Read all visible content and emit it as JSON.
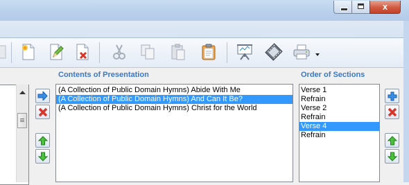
{
  "window": {
    "close_label": "x"
  },
  "toolbar": {
    "icons": [
      "new-document-icon",
      "edit-document-icon",
      "delete-document-icon",
      "cut-icon",
      "copy-icon",
      "paste-icon",
      "clipboard-icon",
      "presentation-easel-icon",
      "film-icon",
      "print-icon"
    ]
  },
  "contents": {
    "title": "Contents of Presentation",
    "items": [
      "(A Collection of Public Domain Hymns) Abide With Me",
      "(A Collection of Public Domain Hymns) And Can It Be?",
      "(A Collection of Public Domain Hymns) Christ for the World"
    ],
    "selected_index": 1
  },
  "sections": {
    "title": "Order of Sections",
    "items": [
      "Verse 1",
      "Refrain",
      "Verse 2",
      "Refrain",
      "Verse 4",
      "Refrain"
    ],
    "selected_index": 4
  },
  "colors": {
    "accent_label": "#3a78c9",
    "selection": "#3399ff"
  }
}
